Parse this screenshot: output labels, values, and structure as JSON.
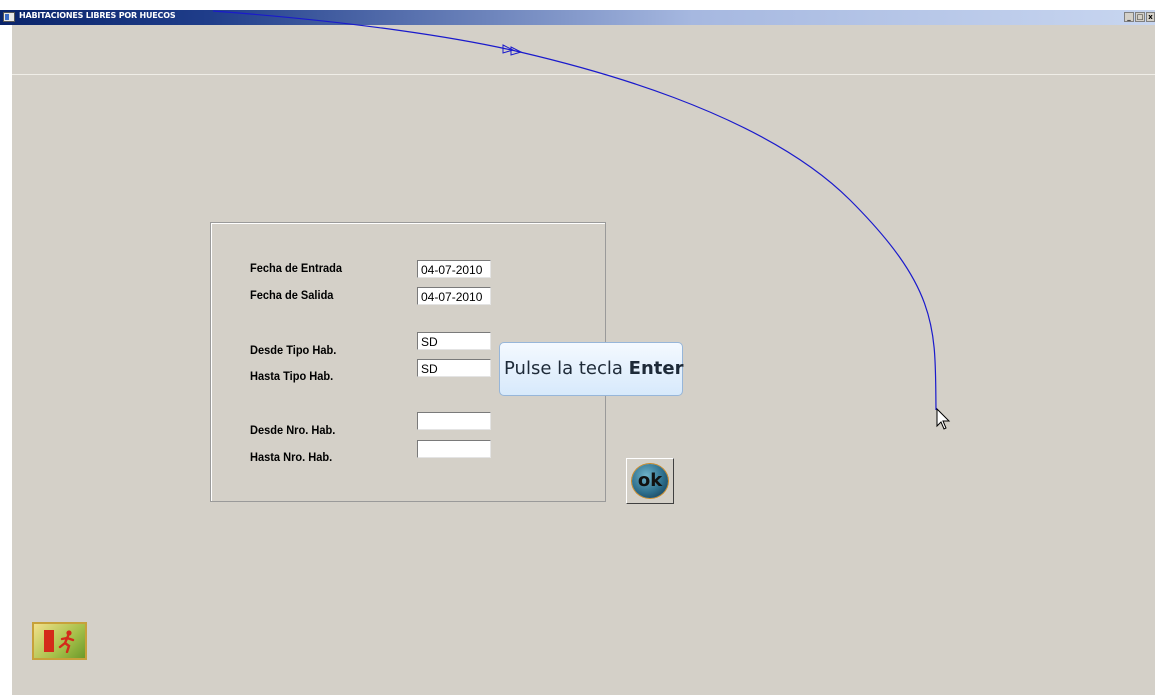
{
  "window": {
    "title": "HABITACIONES LIBRES POR HUECOS",
    "controls": {
      "minimize": "_",
      "maximize": "□",
      "close": "x"
    }
  },
  "form": {
    "fecha_entrada": {
      "label": "Fecha de Entrada",
      "value": "04-07-2010"
    },
    "fecha_salida": {
      "label": "Fecha de Salida",
      "value": "04-07-2010"
    },
    "desde_tipo_hab": {
      "label": "Desde Tipo Hab.",
      "value": "SD"
    },
    "hasta_tipo_hab": {
      "label": "Hasta Tipo Hab.",
      "value": "SD"
    },
    "desde_nro_hab": {
      "label": "Desde Nro. Hab.",
      "value": ""
    },
    "hasta_nro_hab": {
      "label": "Hasta Nro. Hab.",
      "value": ""
    }
  },
  "tooltip": {
    "text": "Pulse la tecla ",
    "key": "Enter"
  },
  "buttons": {
    "ok_label": "ok",
    "exit_icon": "exit-door-running-icon"
  },
  "colors": {
    "titlebar_start": "#0a246a",
    "window_bg": "#d4d0c8",
    "cursor_path": "#1a1acc"
  }
}
